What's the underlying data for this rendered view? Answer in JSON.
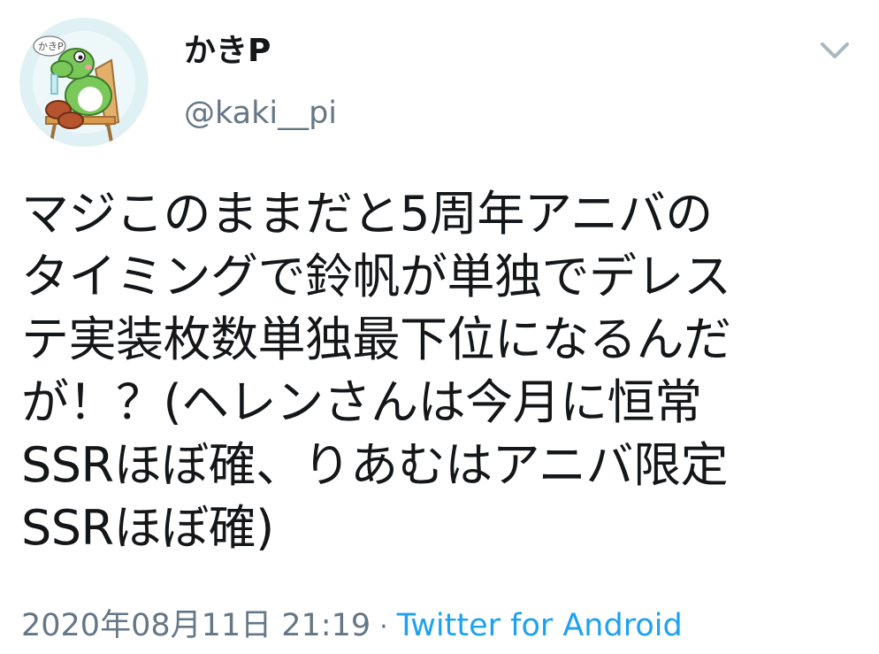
{
  "user": {
    "display_name": "かきP",
    "handle": "@kaki__pi",
    "avatar_icon": "avatar-image-icon",
    "avatar_caption": "かきP"
  },
  "menu": {
    "icon": "chevron-down-icon",
    "color": "#aab8c2"
  },
  "tweet": {
    "lines": [
      "マジこのままだと5周年アニバの",
      "タイミングで鈴帆が単独でデレス",
      "テ実装枚数単独最下位になるんだ",
      "が！？(ヘレンさんは今月に恒常",
      "SSRほぼ確、りあむはアニバ限定",
      "SSRほぼ確)"
    ]
  },
  "meta": {
    "timestamp": "2020年08月11日 21:19",
    "separator": "·",
    "source": "Twitter for Android"
  },
  "colors": {
    "text": "#14171a",
    "secondary": "#657786",
    "link": "#1da1f2"
  }
}
